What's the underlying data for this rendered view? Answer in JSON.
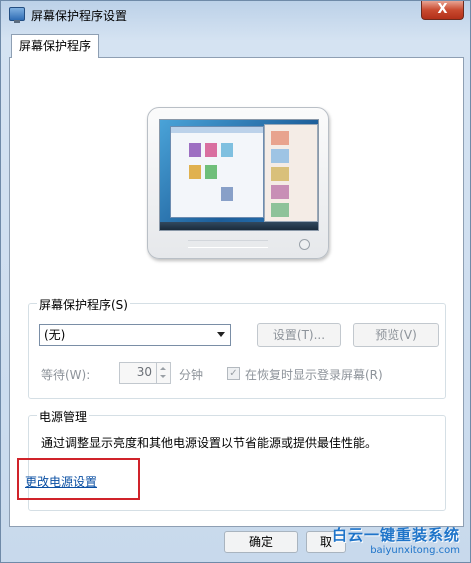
{
  "window": {
    "title": "屏幕保护程序设置",
    "close_label": "X"
  },
  "tab": {
    "label": "屏幕保护程序"
  },
  "screensaver": {
    "group_title": "屏幕保护程序(S)",
    "selected": "(无)",
    "settings_button": "设置(T)...",
    "preview_button": "预览(V)",
    "wait_label": "等待(W):",
    "wait_value": "30",
    "wait_unit": "分钟",
    "resume_checkbox_label": "在恢复时显示登录屏幕(R)",
    "resume_checked": true
  },
  "power": {
    "group_title": "电源管理",
    "description": "通过调整显示亮度和其他电源设置以节省能源或提供最佳性能。",
    "link_label": "更改电源设置"
  },
  "footer": {
    "ok_button": "确定",
    "other_button_partial": "取"
  },
  "watermark": {
    "title": "白云一键重装系统",
    "url": "baiyunxitong.com"
  },
  "colors": {
    "highlight": "#d0232a",
    "link": "#0a4fa3",
    "watermark": "#1e74c9"
  }
}
